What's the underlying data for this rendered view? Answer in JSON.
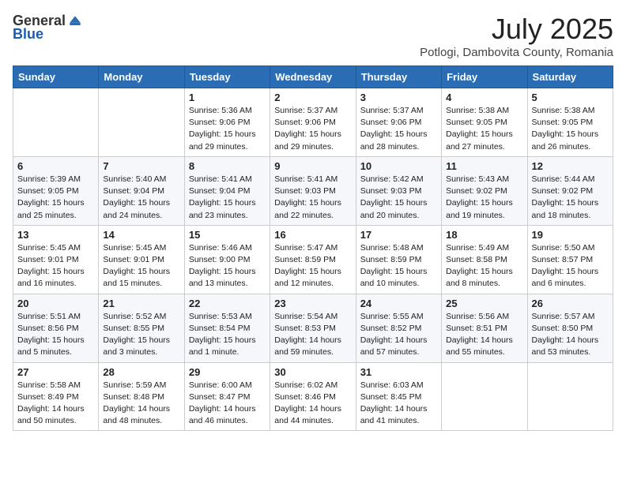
{
  "logo": {
    "general": "General",
    "blue": "Blue"
  },
  "title": "July 2025",
  "location": "Potlogi, Dambovita County, Romania",
  "weekdays": [
    "Sunday",
    "Monday",
    "Tuesday",
    "Wednesday",
    "Thursday",
    "Friday",
    "Saturday"
  ],
  "weeks": [
    [
      {
        "day": "",
        "sunrise": "",
        "sunset": "",
        "daylight": ""
      },
      {
        "day": "",
        "sunrise": "",
        "sunset": "",
        "daylight": ""
      },
      {
        "day": "1",
        "sunrise": "Sunrise: 5:36 AM",
        "sunset": "Sunset: 9:06 PM",
        "daylight": "Daylight: 15 hours and 29 minutes."
      },
      {
        "day": "2",
        "sunrise": "Sunrise: 5:37 AM",
        "sunset": "Sunset: 9:06 PM",
        "daylight": "Daylight: 15 hours and 29 minutes."
      },
      {
        "day": "3",
        "sunrise": "Sunrise: 5:37 AM",
        "sunset": "Sunset: 9:06 PM",
        "daylight": "Daylight: 15 hours and 28 minutes."
      },
      {
        "day": "4",
        "sunrise": "Sunrise: 5:38 AM",
        "sunset": "Sunset: 9:05 PM",
        "daylight": "Daylight: 15 hours and 27 minutes."
      },
      {
        "day": "5",
        "sunrise": "Sunrise: 5:38 AM",
        "sunset": "Sunset: 9:05 PM",
        "daylight": "Daylight: 15 hours and 26 minutes."
      }
    ],
    [
      {
        "day": "6",
        "sunrise": "Sunrise: 5:39 AM",
        "sunset": "Sunset: 9:05 PM",
        "daylight": "Daylight: 15 hours and 25 minutes."
      },
      {
        "day": "7",
        "sunrise": "Sunrise: 5:40 AM",
        "sunset": "Sunset: 9:04 PM",
        "daylight": "Daylight: 15 hours and 24 minutes."
      },
      {
        "day": "8",
        "sunrise": "Sunrise: 5:41 AM",
        "sunset": "Sunset: 9:04 PM",
        "daylight": "Daylight: 15 hours and 23 minutes."
      },
      {
        "day": "9",
        "sunrise": "Sunrise: 5:41 AM",
        "sunset": "Sunset: 9:03 PM",
        "daylight": "Daylight: 15 hours and 22 minutes."
      },
      {
        "day": "10",
        "sunrise": "Sunrise: 5:42 AM",
        "sunset": "Sunset: 9:03 PM",
        "daylight": "Daylight: 15 hours and 20 minutes."
      },
      {
        "day": "11",
        "sunrise": "Sunrise: 5:43 AM",
        "sunset": "Sunset: 9:02 PM",
        "daylight": "Daylight: 15 hours and 19 minutes."
      },
      {
        "day": "12",
        "sunrise": "Sunrise: 5:44 AM",
        "sunset": "Sunset: 9:02 PM",
        "daylight": "Daylight: 15 hours and 18 minutes."
      }
    ],
    [
      {
        "day": "13",
        "sunrise": "Sunrise: 5:45 AM",
        "sunset": "Sunset: 9:01 PM",
        "daylight": "Daylight: 15 hours and 16 minutes."
      },
      {
        "day": "14",
        "sunrise": "Sunrise: 5:45 AM",
        "sunset": "Sunset: 9:01 PM",
        "daylight": "Daylight: 15 hours and 15 minutes."
      },
      {
        "day": "15",
        "sunrise": "Sunrise: 5:46 AM",
        "sunset": "Sunset: 9:00 PM",
        "daylight": "Daylight: 15 hours and 13 minutes."
      },
      {
        "day": "16",
        "sunrise": "Sunrise: 5:47 AM",
        "sunset": "Sunset: 8:59 PM",
        "daylight": "Daylight: 15 hours and 12 minutes."
      },
      {
        "day": "17",
        "sunrise": "Sunrise: 5:48 AM",
        "sunset": "Sunset: 8:59 PM",
        "daylight": "Daylight: 15 hours and 10 minutes."
      },
      {
        "day": "18",
        "sunrise": "Sunrise: 5:49 AM",
        "sunset": "Sunset: 8:58 PM",
        "daylight": "Daylight: 15 hours and 8 minutes."
      },
      {
        "day": "19",
        "sunrise": "Sunrise: 5:50 AM",
        "sunset": "Sunset: 8:57 PM",
        "daylight": "Daylight: 15 hours and 6 minutes."
      }
    ],
    [
      {
        "day": "20",
        "sunrise": "Sunrise: 5:51 AM",
        "sunset": "Sunset: 8:56 PM",
        "daylight": "Daylight: 15 hours and 5 minutes."
      },
      {
        "day": "21",
        "sunrise": "Sunrise: 5:52 AM",
        "sunset": "Sunset: 8:55 PM",
        "daylight": "Daylight: 15 hours and 3 minutes."
      },
      {
        "day": "22",
        "sunrise": "Sunrise: 5:53 AM",
        "sunset": "Sunset: 8:54 PM",
        "daylight": "Daylight: 15 hours and 1 minute."
      },
      {
        "day": "23",
        "sunrise": "Sunrise: 5:54 AM",
        "sunset": "Sunset: 8:53 PM",
        "daylight": "Daylight: 14 hours and 59 minutes."
      },
      {
        "day": "24",
        "sunrise": "Sunrise: 5:55 AM",
        "sunset": "Sunset: 8:52 PM",
        "daylight": "Daylight: 14 hours and 57 minutes."
      },
      {
        "day": "25",
        "sunrise": "Sunrise: 5:56 AM",
        "sunset": "Sunset: 8:51 PM",
        "daylight": "Daylight: 14 hours and 55 minutes."
      },
      {
        "day": "26",
        "sunrise": "Sunrise: 5:57 AM",
        "sunset": "Sunset: 8:50 PM",
        "daylight": "Daylight: 14 hours and 53 minutes."
      }
    ],
    [
      {
        "day": "27",
        "sunrise": "Sunrise: 5:58 AM",
        "sunset": "Sunset: 8:49 PM",
        "daylight": "Daylight: 14 hours and 50 minutes."
      },
      {
        "day": "28",
        "sunrise": "Sunrise: 5:59 AM",
        "sunset": "Sunset: 8:48 PM",
        "daylight": "Daylight: 14 hours and 48 minutes."
      },
      {
        "day": "29",
        "sunrise": "Sunrise: 6:00 AM",
        "sunset": "Sunset: 8:47 PM",
        "daylight": "Daylight: 14 hours and 46 minutes."
      },
      {
        "day": "30",
        "sunrise": "Sunrise: 6:02 AM",
        "sunset": "Sunset: 8:46 PM",
        "daylight": "Daylight: 14 hours and 44 minutes."
      },
      {
        "day": "31",
        "sunrise": "Sunrise: 6:03 AM",
        "sunset": "Sunset: 8:45 PM",
        "daylight": "Daylight: 14 hours and 41 minutes."
      },
      {
        "day": "",
        "sunrise": "",
        "sunset": "",
        "daylight": ""
      },
      {
        "day": "",
        "sunrise": "",
        "sunset": "",
        "daylight": ""
      }
    ]
  ]
}
